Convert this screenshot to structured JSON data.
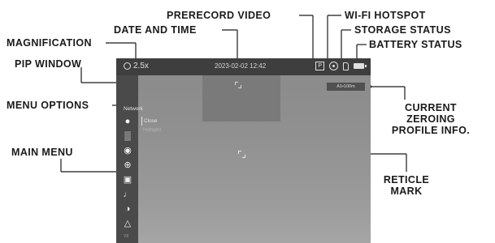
{
  "callouts": {
    "magnification": "MAGNIFICATION",
    "pip_window": "PIP WINDOW",
    "menu_options": "MENU OPTIONS",
    "main_menu": "MAIN MENU",
    "date_and_time": "DATE AND TIME",
    "prerecord_video": "PRERECORD VIDEO",
    "wifi_hotspot": "WI-FI HOTSPOT",
    "storage_status": "STORAGE STATUS",
    "battery_status": "BATTERY STATUS",
    "current_zeroing_line1": "CURRENT",
    "current_zeroing_line2": "ZEROING",
    "current_zeroing_line3": "PROFILE INFO.",
    "reticle_line1": "RETICLE",
    "reticle_line2": "MARK"
  },
  "screen": {
    "magnification": "2.5x",
    "datetime": "2023-02-02 12:42",
    "prerecord_label": "P",
    "zeroing_profile": "A1•100m",
    "menu": {
      "title": "Network",
      "options": [
        "Close",
        "Hotspot"
      ],
      "version": "V8"
    }
  },
  "icons": {
    "magnification": "magnifier-icon",
    "prerecord": "prerecord-video-icon",
    "wifi": "wifi-hotspot-icon",
    "storage": "sd-card-icon",
    "battery": "battery-icon",
    "menu": [
      "network-icon",
      "ruler-icon",
      "target-icon",
      "crosshair-icon",
      "record-icon",
      "microphone-icon",
      "brightness-icon",
      "warning-icon"
    ]
  },
  "colors": {
    "screen_bar": "#3e3e3e",
    "screen_view": "#909090",
    "pip": "#7a7a7a",
    "label_text": "#1a1a1a"
  }
}
